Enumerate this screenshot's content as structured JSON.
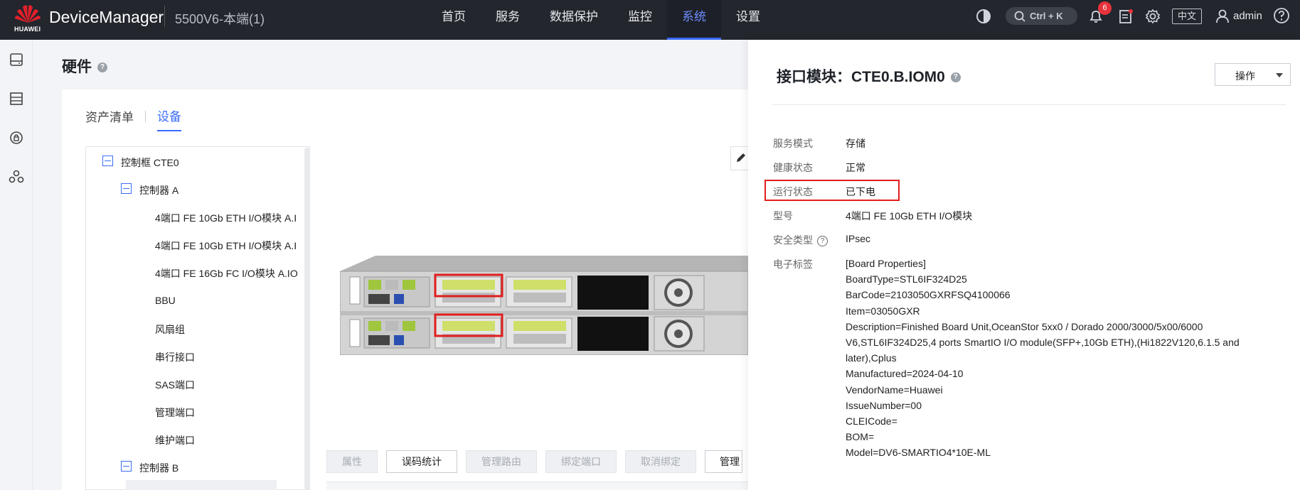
{
  "header": {
    "logo_text": "HUAWEI",
    "app_title": "DeviceManager",
    "device_name": "5500V6-本端(1)",
    "nav": [
      {
        "label": "首页"
      },
      {
        "label": "服务"
      },
      {
        "label": "数据保护"
      },
      {
        "label": "监控"
      },
      {
        "label": "系统",
        "active": true
      },
      {
        "label": "设置"
      }
    ],
    "search_shortcut": "Ctrl + K",
    "notification_count": "6",
    "language": "中文",
    "user": "admin",
    "accent_color": "#3b6cf6",
    "bar_color": "#23262d"
  },
  "rail": {
    "icons": [
      "disk-icon",
      "storage-icon",
      "security-icon",
      "cluster-icon"
    ]
  },
  "main": {
    "page_title": "硬件",
    "tabs": [
      {
        "label": "资产清单"
      },
      {
        "label": "设备",
        "active": true
      }
    ],
    "tree": [
      {
        "label": "控制框 CTE0",
        "level": 0,
        "toggle": true
      },
      {
        "label": "控制器 A",
        "level": 1,
        "toggle": true
      },
      {
        "label": "4端口 FE 10Gb ETH I/O模块 A.I",
        "level": 2
      },
      {
        "label": "4端口 FE 10Gb ETH I/O模块 A.I",
        "level": 2
      },
      {
        "label": "4端口 FE 16Gb FC I/O模块 A.IO",
        "level": 2
      },
      {
        "label": "BBU",
        "level": 2
      },
      {
        "label": "风扇组",
        "level": 2
      },
      {
        "label": "串行接口",
        "level": 2
      },
      {
        "label": "SAS端口",
        "level": 2
      },
      {
        "label": "管理端口",
        "level": 2
      },
      {
        "label": "维护端口",
        "level": 2
      },
      {
        "label": "控制器 B",
        "level": 1,
        "toggle": true
      }
    ],
    "actions": [
      {
        "label": "属性",
        "enabled": false
      },
      {
        "label": "误码统计",
        "enabled": true
      },
      {
        "label": "管理路由",
        "enabled": false
      },
      {
        "label": "绑定端口",
        "enabled": false
      },
      {
        "label": "取消绑定",
        "enabled": false
      },
      {
        "label": "管理",
        "enabled": true
      }
    ]
  },
  "panel": {
    "title": "接口模块：CTE0.B.IOM0",
    "ops_label": "操作",
    "props": [
      {
        "label": "服务模式",
        "value": "存储"
      },
      {
        "label": "健康状态",
        "value": "正常"
      },
      {
        "label": "运行状态",
        "value": "已下电"
      },
      {
        "label": "型号",
        "value": "4端口 FE 10Gb ETH I/O模块"
      },
      {
        "label": "安全类型",
        "value": "IPsec"
      },
      {
        "label": "电子标签",
        "value": ""
      }
    ],
    "electronic_label": [
      "[Board Properties]",
      "BoardType=STL6IF324D25",
      "BarCode=2103050GXRFSQ4100066",
      "Item=03050GXR",
      "Description=Finished Board Unit,OceanStor 5xx0 / Dorado 2000/3000/5x00/6000 V6,STL6IF324D25,4 ports SmartIO I/O module(SFP+,10Gb ETH),(Hi1822V120,6.1.5 and later),Cplus",
      "Manufactured=2024-04-10",
      "VendorName=Huawei",
      "IssueNumber=00",
      "CLEICode=",
      "BOM=",
      "Model=DV6-SMARTIO4*10E-ML"
    ],
    "highlight_color": "#e01d1d"
  }
}
